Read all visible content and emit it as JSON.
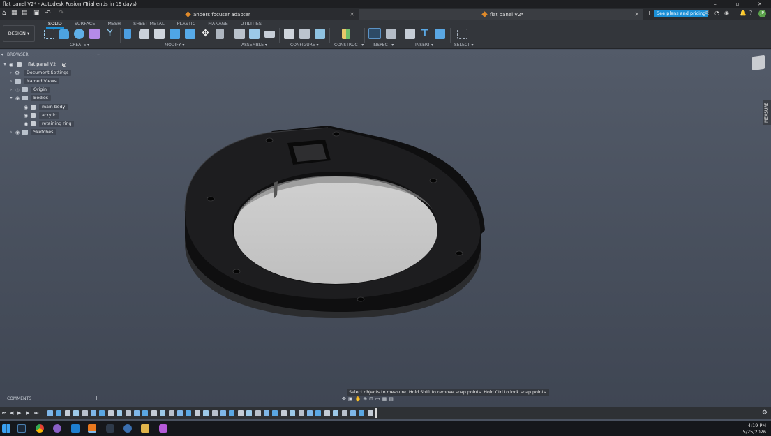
{
  "window": {
    "title": "flat panel V2* - Autodesk Fusion (Trial ends in 19 days)",
    "controls": [
      "–",
      "▫",
      "✕"
    ]
  },
  "tabs": [
    {
      "label": "anders focuser adapter",
      "active": false
    },
    {
      "label": "flat panel V2*",
      "active": true
    }
  ],
  "header_right": {
    "plans_button": "See plans and pricing",
    "avatar_initials": "JP"
  },
  "toolbar": {
    "workspace_button": "DESIGN",
    "workspace_tabs": [
      "SOLID",
      "SURFACE",
      "MESH",
      "SHEET METAL",
      "PLASTIC",
      "MANAGE",
      "UTILITIES"
    ],
    "active_tab": "SOLID",
    "groups": [
      "CREATE",
      "MODIFY",
      "ASSEMBLE",
      "CONFIGURE",
      "CONSTRUCT",
      "INSPECT",
      "INSERT",
      "SELECT"
    ]
  },
  "browser": {
    "title": "BROWSER",
    "root": "flat panel V2",
    "items": [
      {
        "label": "Document Settings",
        "icon": "gear-icon"
      },
      {
        "label": "Named Views",
        "icon": "folder-icon"
      },
      {
        "label": "Origin",
        "icon": "folder-icon"
      },
      {
        "label": "Bodies",
        "icon": "folder-icon"
      },
      {
        "label": "main body",
        "icon": "body-icon"
      },
      {
        "label": "acrylic",
        "icon": "body-icon"
      },
      {
        "label": "retaining ring",
        "icon": "body-icon"
      },
      {
        "label": "Sketches",
        "icon": "folder-icon"
      }
    ]
  },
  "viewport": {
    "measure_tab": "MEASURE",
    "status_tip": "Select objects to measure. Hold Shift to remove snap points. Hold Ctrl to lock snap points."
  },
  "comments": {
    "title": "COMMENTS"
  },
  "timeline": {
    "feature_count": 38
  },
  "taskbar": {
    "time": "4:19 PM",
    "date": "5/25/2026"
  },
  "colors": {
    "accent": "#1b8fd6",
    "viewport_bg": "#4a5260",
    "model_body": "#1a1a1b",
    "acrylic": "#c9c9c9"
  }
}
